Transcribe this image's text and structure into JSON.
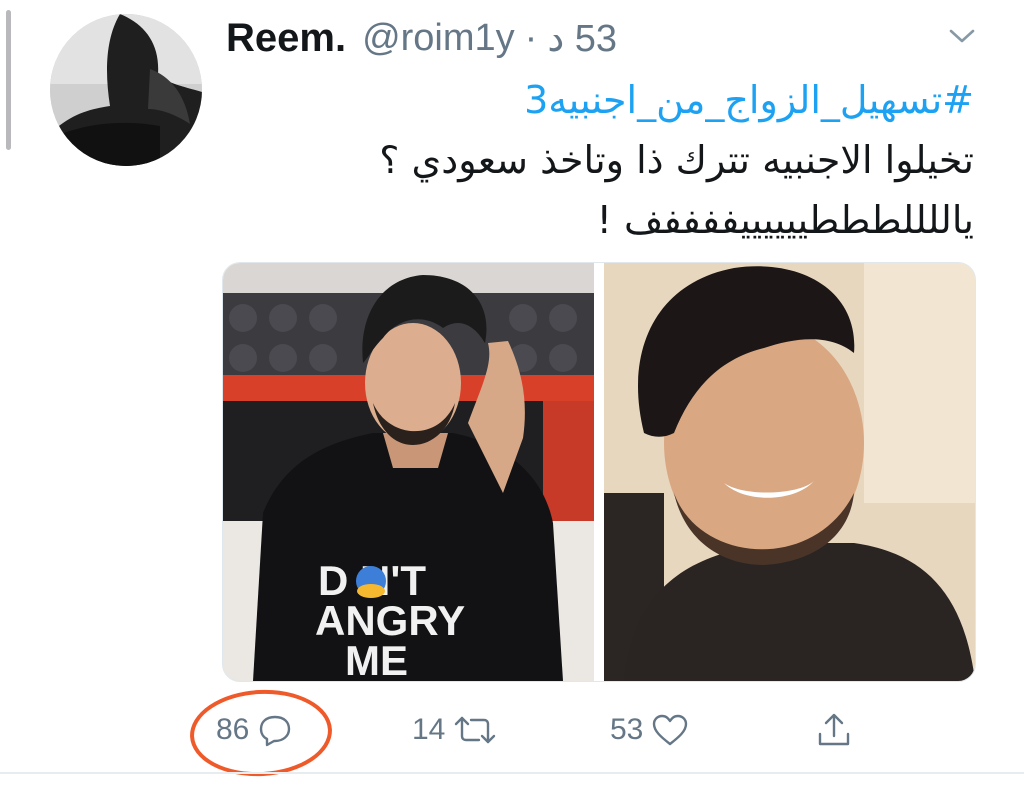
{
  "tweet": {
    "display_name": "Reem.",
    "handle": "@roim1y",
    "separator": "·",
    "time": "53 د",
    "hashtag": "#تسهيل_الزواج_من_اجنبيه3",
    "text_lines": [
      "تخيلوا الاجنبيه تترك ذا وتاخذ سعودي ؟",
      "ياللللطططييييييففففف !"
    ],
    "media": {
      "left_photo_shirt_text": [
        "D  N'T",
        "ANGRY",
        "ME"
      ]
    }
  },
  "actions": {
    "reply": {
      "count": "86",
      "icon": "reply-icon"
    },
    "retweet": {
      "count": "14",
      "icon": "retweet-icon"
    },
    "like": {
      "count": "53",
      "icon": "heart-icon"
    },
    "share": {
      "icon": "share-icon"
    }
  },
  "colors": {
    "hashtag": "#1da1f2",
    "meta_text": "#657786",
    "annotation_ring": "#ef5a2b"
  }
}
